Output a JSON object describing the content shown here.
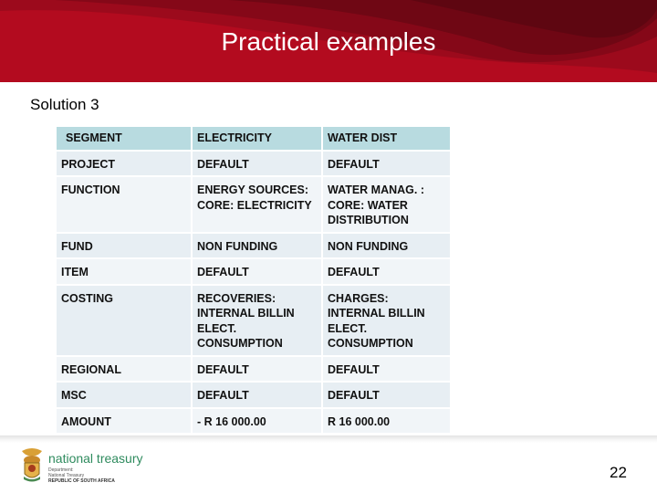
{
  "header": {
    "title": "Practical examples",
    "color": "#b20a1e"
  },
  "subtitle": "Solution 3",
  "table": {
    "rows": [
      [
        "SEGMENT",
        "ELECTRICITY",
        "WATER DIST"
      ],
      [
        "PROJECT",
        "DEFAULT",
        "DEFAULT"
      ],
      [
        "FUNCTION",
        "ENERGY SOURCES: CORE: ELECTRICITY",
        "WATER MANAG. : CORE: WATER DISTRIBUTION"
      ],
      [
        "FUND",
        "NON FUNDING",
        "NON FUNDING"
      ],
      [
        "ITEM",
        "DEFAULT",
        "DEFAULT"
      ],
      [
        "COSTING",
        "RECOVERIES: INTERNAL BILLIN ELECT. CONSUMPTION",
        "CHARGES: INTERNAL BILLIN ELECT. CONSUMPTION"
      ],
      [
        "REGIONAL",
        "DEFAULT",
        "DEFAULT"
      ],
      [
        "MSC",
        "DEFAULT",
        "DEFAULT"
      ],
      [
        "AMOUNT",
        "- R 16 000.00",
        "R 16 000.00"
      ]
    ]
  },
  "footer": {
    "logo_icon": "coat-of-arms-icon",
    "logo_name": "national treasury",
    "logo_sub": [
      "Department:",
      "National Treasury",
      "REPUBLIC OF SOUTH AFRICA"
    ],
    "page_number": "22"
  }
}
